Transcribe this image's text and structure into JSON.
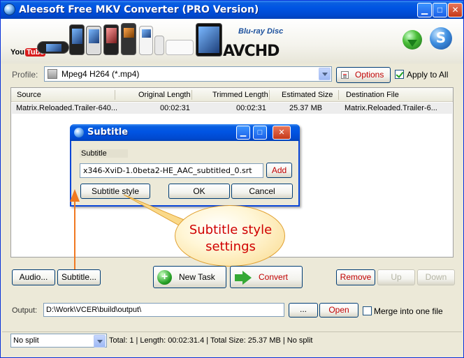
{
  "window": {
    "title": "Aleesoft Free MKV Converter (PRO Version)"
  },
  "banner": {
    "youtube": "You",
    "youtube_tube": "Tube",
    "bluray": "Blu-ray Disc",
    "avchd": "AVCHD",
    "badge": "S"
  },
  "profile": {
    "label": "Profile:",
    "value": "Mpeg4 H264 (*.mp4)",
    "options_label": "Options",
    "apply_all_label": "Apply to All",
    "apply_all_checked": true
  },
  "file_list": {
    "columns": [
      "Source",
      "Original Length",
      "Trimmed Length",
      "Estimated Size",
      "Destination File"
    ],
    "rows": [
      {
        "source": "Matrix.Reloaded.Trailer-640...",
        "original_length": "00:02:31",
        "trimmed_length": "00:02:31",
        "estimated_size": "25.37 MB",
        "destination": "Matrix.Reloaded.Trailer-6..."
      }
    ]
  },
  "subtitle_dialog": {
    "title": "Subtitle",
    "label": "Subtitle",
    "file_value": "x346-XviD-1.0beta2-HE_AAC_subtitled_0.srt",
    "add_label": "Add",
    "style_label": "Subtitle style",
    "ok_label": "OK",
    "cancel_label": "Cancel"
  },
  "callout": {
    "line1": "Subtitle style",
    "line2": "settings"
  },
  "toolbar": {
    "audio_label": "Audio...",
    "subtitle_label": "Subtitle...",
    "new_task_label": "New Task",
    "convert_label": "Convert",
    "remove_label": "Remove",
    "up_label": "Up",
    "down_label": "Down"
  },
  "output": {
    "label": "Output:",
    "path": "D:\\Work\\VCER\\build\\output\\",
    "browse_label": "...",
    "open_label": "Open",
    "merge_label": "Merge into one file",
    "merge_checked": false
  },
  "status": {
    "split_value": "No split",
    "summary": "Total: 1 | Length: 00:02:31.4 | Total Size: 25.37 MB | No split"
  }
}
